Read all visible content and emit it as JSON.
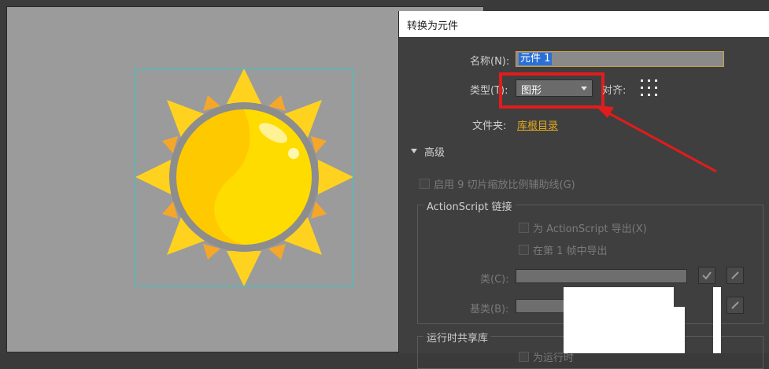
{
  "dialog": {
    "title": "转换为元件",
    "name_label": "名称(N):",
    "name_value": "元件 1",
    "type_label": "类型(T):",
    "type_value": "图形",
    "align_label": "对齐:",
    "folder_label": "文件夹:",
    "folder_value": "库根目录",
    "advanced_label": "高级",
    "enable_guides_label": "启用 9 切片缩放比例辅助线(G)",
    "actionscript_group_title": "ActionScript 链接",
    "export_as_label": "为 ActionScript 导出(X)",
    "export_frame1_label": "在第 1 帧中导出",
    "class_label": "类(C):",
    "base_class_label": "基类(B):",
    "runtime_group_title": "运行时共享库",
    "runtime_export_label": "为运行时"
  },
  "colors": {
    "stage_bg": "#9b9b9b",
    "highlight_red": "#e01c1c",
    "link_orange": "#e3a91e",
    "selection_cyan": "#37c8c8",
    "sun_yellow": "#ffd300"
  },
  "icons": {
    "type_dropdown": "chevron-down-icon",
    "align_registration": "registration-grid-icon",
    "advanced_toggle": "triangle-down-icon",
    "check": "checkmark-icon",
    "edit": "pencil-icon"
  }
}
